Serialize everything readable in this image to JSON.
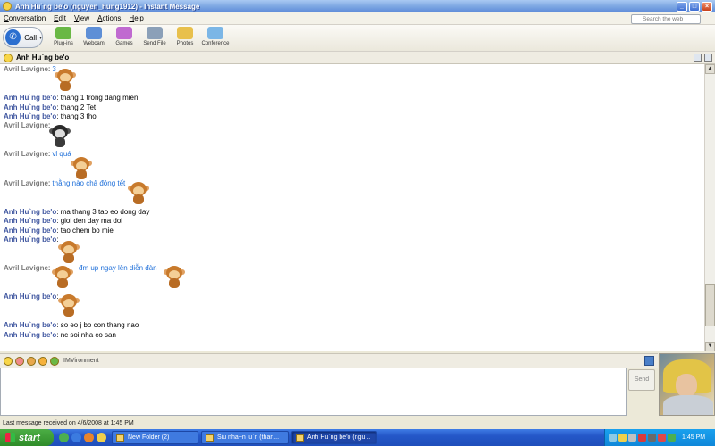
{
  "window": {
    "title": "Anh Hu`ng be'o (nguyen_hung1912) - Instant Message",
    "controls": [
      "minimize",
      "maximize",
      "close"
    ]
  },
  "menu": [
    "Conversation",
    "Edit",
    "View",
    "Actions",
    "Help"
  ],
  "search": {
    "placeholder": "Search the web"
  },
  "toolbar": {
    "call_label": "Call",
    "tools": [
      {
        "label": "Plug-ins",
        "icon": "plugins-icon",
        "color": "#6ab845"
      },
      {
        "label": "Webcam",
        "icon": "webcam-icon",
        "color": "#5e8fd6"
      },
      {
        "label": "Games",
        "icon": "games-icon",
        "color": "#c06ad0"
      },
      {
        "label": "Send File",
        "icon": "send-file-icon",
        "color": "#8ba0b8"
      },
      {
        "label": "Photos",
        "icon": "photos-icon",
        "color": "#e8c04c"
      },
      {
        "label": "Conference",
        "icon": "conference-icon",
        "color": "#7bb6e6"
      }
    ]
  },
  "conversation": {
    "contact_name": "Anh Hu`ng be'o",
    "messages": [
      {
        "sender": "Avril Lavigne",
        "text": "3"
      },
      {
        "sender": "Anh Hu`ng be'o",
        "text": "thang 1 trong dang mien"
      },
      {
        "sender": "Anh Hu`ng be'o",
        "text": "thang 2 Tet"
      },
      {
        "sender": "Anh Hu`ng be'o",
        "text": "thang 3 thoi"
      },
      {
        "sender": "Avril Lavigne",
        "text": ""
      },
      {
        "sender": "Avril Lavigne",
        "text": "vl quá"
      },
      {
        "sender": "Avril Lavigne",
        "text": "thằng nào chả đông tết"
      },
      {
        "sender": "Anh Hu`ng be'o",
        "text": "ma thang 3 tao eo dong day"
      },
      {
        "sender": "Anh Hu`ng be'o",
        "text": "gioi den day ma doi"
      },
      {
        "sender": "Anh Hu`ng be'o",
        "text": "tao chem bo mie"
      },
      {
        "sender": "Anh Hu`ng be'o",
        "text": ""
      },
      {
        "sender": "Avril Lavigne",
        "text": "đm up ngay lên diễn đàn"
      },
      {
        "sender": "Anh Hu`ng be'o",
        "text": ""
      },
      {
        "sender": "Anh Hu`ng be'o",
        "text": "so eo j bo con thang nao"
      },
      {
        "sender": "Anh Hu`ng be'o",
        "text": "nc soi nha co san"
      }
    ],
    "colors": {
      "self_sender": "#4057a0",
      "other_sender": "#7a7a7a",
      "other_text": "#1e6fd9"
    }
  },
  "compose": {
    "imvironment_label": "IMVironment",
    "send_label": "Send",
    "input_value": ""
  },
  "status": {
    "last_message": "Last message received on 4/6/2008 at 1:45 PM"
  },
  "taskbar": {
    "start_label": "start",
    "tasks": [
      {
        "label": "New Folder (2)",
        "active": false
      },
      {
        "label": "Siu nha~n lu`n (than...",
        "active": false
      },
      {
        "label": "Anh Hu`ng be'o (ngu...",
        "active": true
      }
    ],
    "clock": "1:45 PM"
  }
}
